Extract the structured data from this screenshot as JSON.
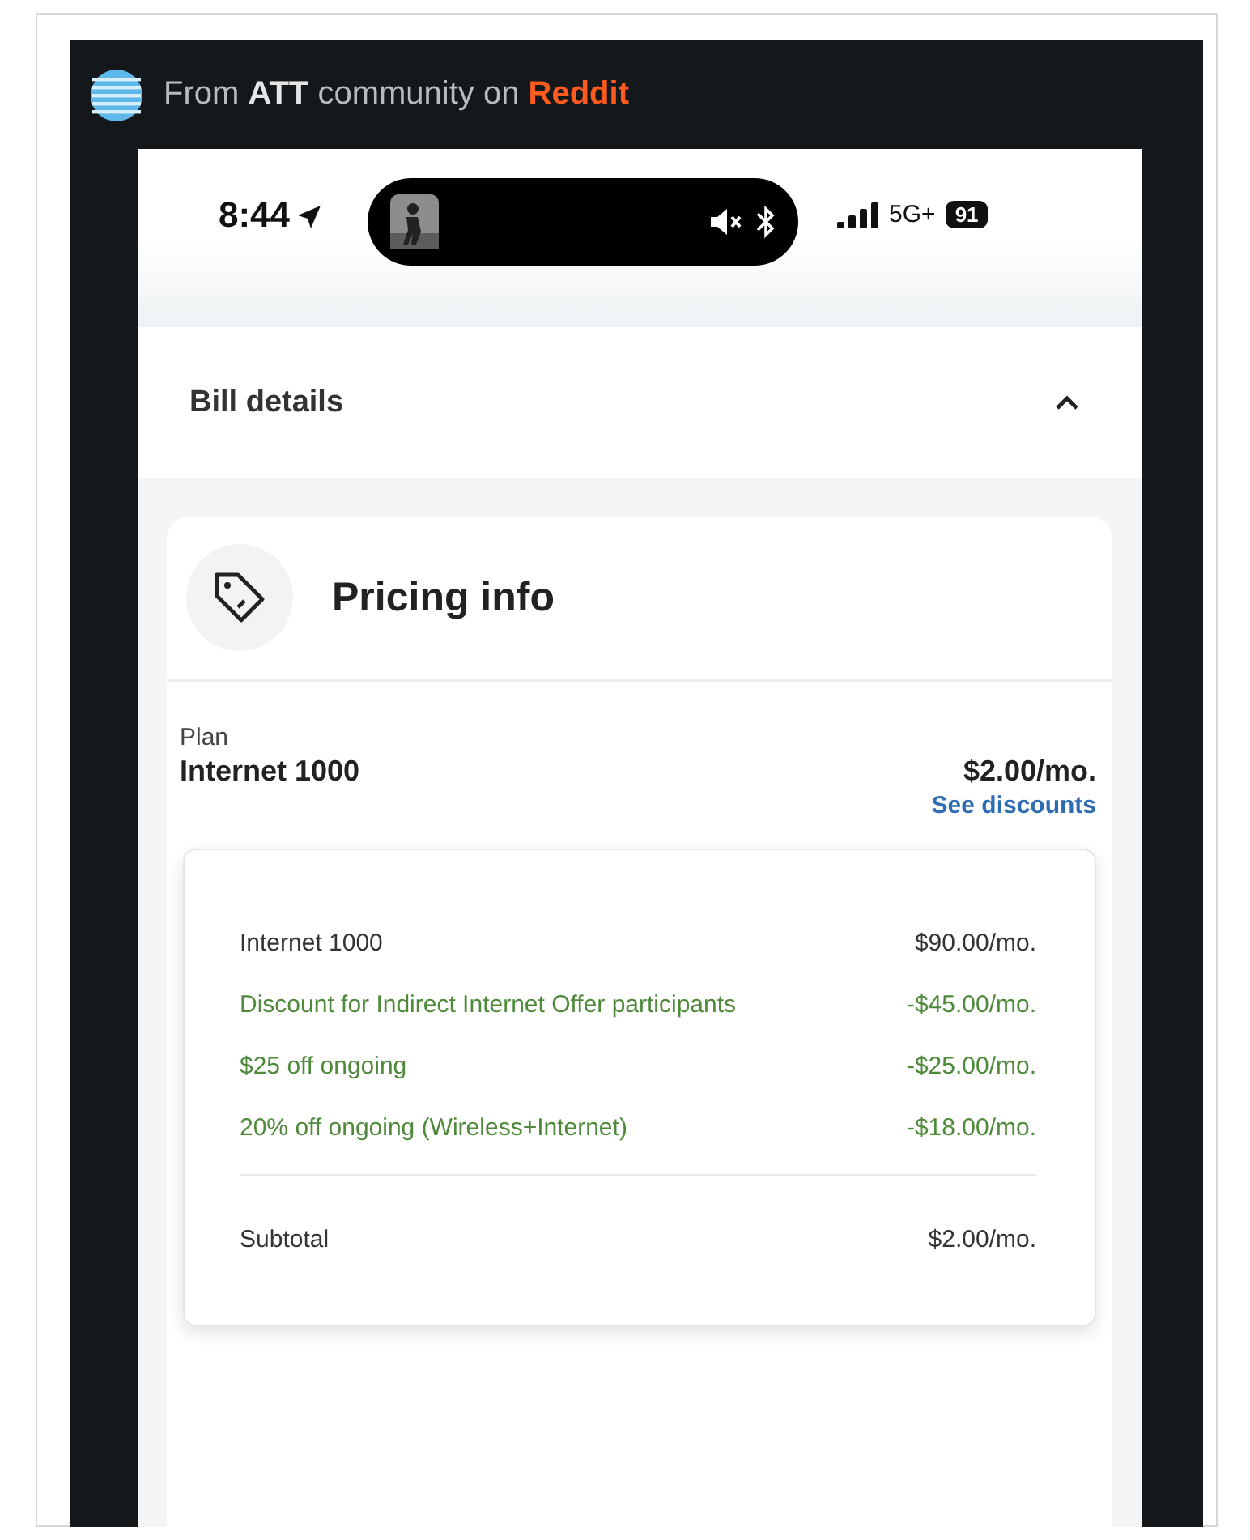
{
  "header": {
    "prefix": "From",
    "brand": "ATT",
    "middle": "community on",
    "source": "Reddit"
  },
  "status_bar": {
    "time": "8:44",
    "network": "5G+",
    "battery": "91"
  },
  "section": {
    "title": "Bill details",
    "expanded": true
  },
  "card": {
    "title": "Pricing info"
  },
  "plan": {
    "label": "Plan",
    "name": "Internet 1000",
    "price": "$2.00/mo.",
    "link": "See discounts"
  },
  "breakdown": [
    {
      "kind": "item",
      "label": "Internet 1000",
      "amount": "$90.00/mo."
    },
    {
      "kind": "discount",
      "label": "Discount for Indirect Internet Offer participants",
      "amount": "-$45.00/mo."
    },
    {
      "kind": "discount",
      "label": "$25 off ongoing",
      "amount": "-$25.00/mo."
    },
    {
      "kind": "discount",
      "label": "20% off ongoing (Wireless+Internet)",
      "amount": "-$18.00/mo."
    }
  ],
  "subtotal": {
    "label": "Subtotal",
    "amount": "$2.00/mo."
  }
}
